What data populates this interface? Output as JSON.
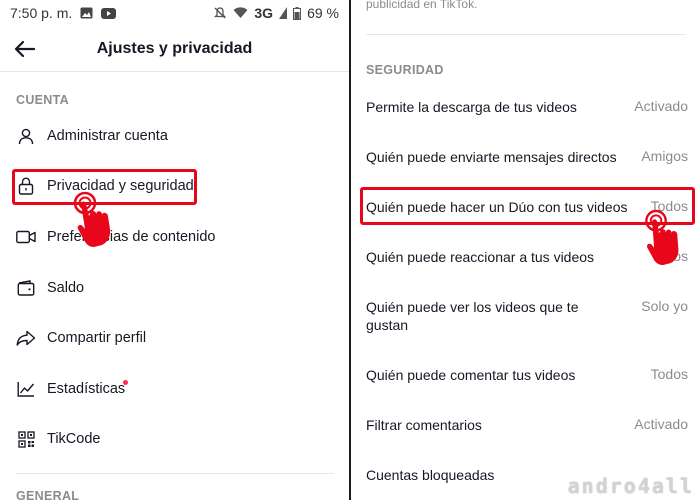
{
  "statusbar": {
    "time": "7:50 p. m.",
    "network": "3G",
    "battery": "69 %"
  },
  "header": {
    "title": "Ajustes y privacidad"
  },
  "left": {
    "section_cuenta": "CUENTA",
    "items": [
      {
        "label": "Administrar cuenta",
        "icon": "person-icon"
      },
      {
        "label": "Privacidad y seguridad",
        "icon": "lock-icon"
      },
      {
        "label": "Preferencias de contenido",
        "icon": "video-icon"
      },
      {
        "label": "Saldo",
        "icon": "wallet-icon"
      },
      {
        "label": "Compartir perfil",
        "icon": "share-icon"
      },
      {
        "label": "Estadísticas",
        "icon": "stats-icon"
      },
      {
        "label": "TikCode",
        "icon": "qr-icon"
      }
    ],
    "section_general": "GENERAL"
  },
  "right": {
    "top_text": "publicidad en TikTok.",
    "section_seguridad": "SEGURIDAD",
    "rows": [
      {
        "label": "Permite la descarga de tus videos",
        "value": "Activado"
      },
      {
        "label": "Quién puede enviarte mensajes directos",
        "value": "Amigos"
      },
      {
        "label": "Quién puede hacer un Dúo con tus videos",
        "value": "Todos"
      },
      {
        "label": "Quién puede reaccionar a tus videos",
        "value": "Todos"
      },
      {
        "label": "Quién puede ver los videos que te gustan",
        "value": "Solo yo"
      },
      {
        "label": "Quién puede comentar tus videos",
        "value": "Todos"
      },
      {
        "label": "Filtrar comentarios",
        "value": "Activado"
      },
      {
        "label": "Cuentas bloqueadas",
        "value": ""
      }
    ]
  },
  "watermark": "andro4all",
  "colors": {
    "highlight": "#e8071a",
    "accent_dot": "#fe2c55",
    "secondary_text": "#8a8b91"
  }
}
